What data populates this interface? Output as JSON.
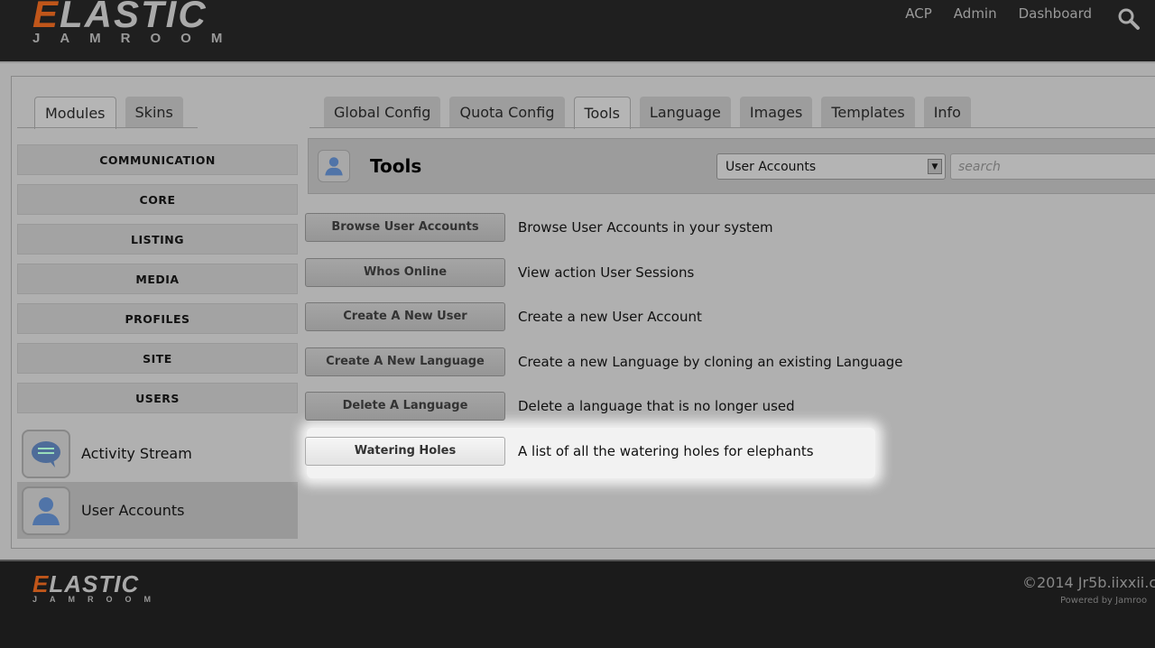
{
  "header": {
    "logo_big": "ELASTIC",
    "logo_small": "JAMROOM",
    "nav": [
      "ACP",
      "Admin",
      "Dashboard"
    ]
  },
  "left_tabs": [
    "Modules",
    "Skins"
  ],
  "right_tabs": [
    "Global Config",
    "Quota Config",
    "Tools",
    "Language",
    "Images",
    "Templates",
    "Info"
  ],
  "categories": [
    "COMMUNICATION",
    "CORE",
    "LISTING",
    "MEDIA",
    "PROFILES",
    "SITE",
    "USERS"
  ],
  "modules": [
    "Activity Stream",
    "User Accounts"
  ],
  "tools_header": {
    "title": "Tools",
    "select_value": "User Accounts",
    "search_placeholder": "search"
  },
  "tools": [
    {
      "label": "Browse User Accounts",
      "desc": "Browse User Accounts in your system"
    },
    {
      "label": "Whos Online",
      "desc": "View action User Sessions"
    },
    {
      "label": "Create A New User",
      "desc": "Create a new User Account"
    },
    {
      "label": "Create A New Language",
      "desc": "Create a new Language by cloning an existing Language"
    },
    {
      "label": "Delete A Language",
      "desc": "Delete a language that is no longer used"
    },
    {
      "label": "Watering Holes",
      "desc": "A list of all the watering holes for elephants"
    }
  ],
  "footer": {
    "copyright": "©2014 Jr5b.iixxii.c",
    "powered": "Powered by Jamroo"
  }
}
